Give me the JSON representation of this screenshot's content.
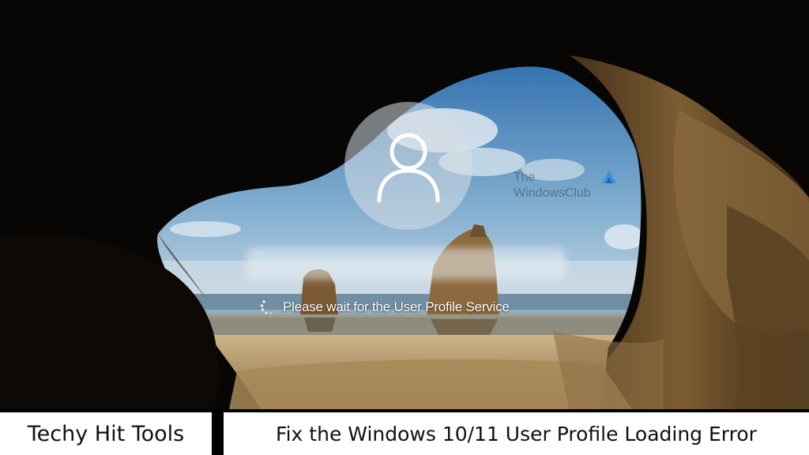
{
  "lock_screen": {
    "avatar_icon": "user-icon",
    "username": "",
    "status_text": "Please wait for the User Profile Service",
    "spinner_icon": "loading-spinner-icon",
    "watermark": {
      "line1": "The",
      "line2": "WindowsClub",
      "logo_icon": "windowsclub-logo-icon"
    }
  },
  "caption": {
    "brand": "Techy Hit Tools",
    "headline": "Fix the Windows 10/11 User Profile Loading Error"
  },
  "colors": {
    "sky_top": "#3f7fb6",
    "sky_bottom": "#b9d2e2",
    "sea": "#6c8fa3",
    "sand": "#b99a6c",
    "cave_rock": "#0b0806",
    "cave_rim": "#6a4e2b",
    "caption_bg": "#ffffff",
    "caption_text": "#111111"
  }
}
